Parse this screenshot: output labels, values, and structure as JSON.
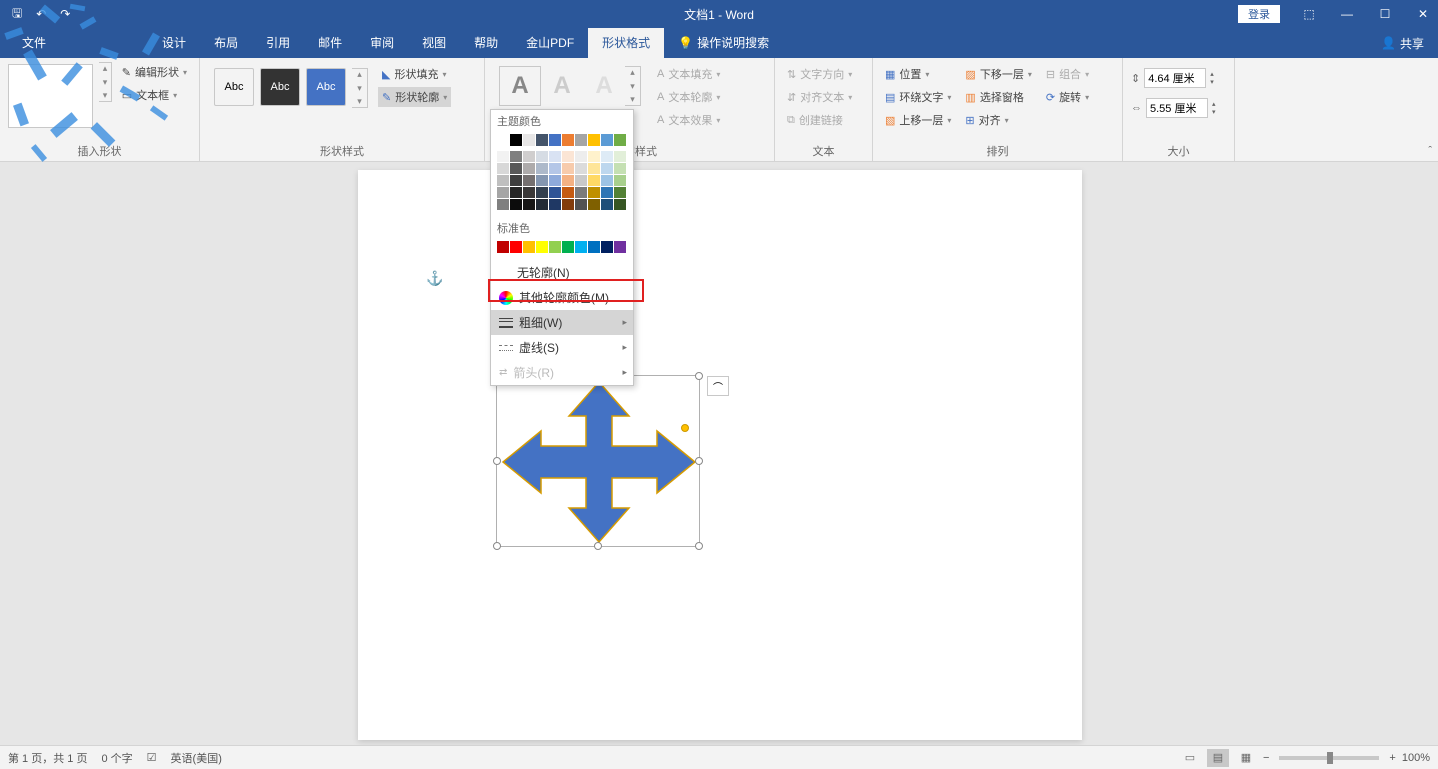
{
  "title_bar": {
    "document_title": "文档1 - Word",
    "login_button": "登录"
  },
  "tabs": {
    "file": "文件",
    "design": "设计",
    "layout": "布局",
    "references": "引用",
    "mailings": "邮件",
    "review": "审阅",
    "view": "视图",
    "help": "帮助",
    "kingsoft_pdf": "金山PDF",
    "shape_format": "形状格式",
    "tell_me": "操作说明搜索",
    "share": "共享"
  },
  "ribbon": {
    "insert_shapes_group": "插入形状",
    "edit_shape": "编辑形状",
    "text_box": "文本框",
    "shape_styles_group": "形状样式",
    "style_abc": "Abc",
    "shape_fill": "形状填充",
    "shape_outline": "形状轮廓",
    "wordart_styles_group": "艺术字样式",
    "text_fill": "文本填充",
    "text_outline": "文本轮廓",
    "text_effects": "文本效果",
    "text_group": "文本",
    "text_direction": "文字方向",
    "align_text": "对齐文本",
    "create_link": "创建链接",
    "arrange_group": "排列",
    "position": "位置",
    "wrap_text": "环绕文字",
    "bring_forward": "上移一层",
    "send_backward": "下移一层",
    "selection_pane": "选择窗格",
    "align": "对齐",
    "group_btn": "组合",
    "rotate": "旋转",
    "size_group": "大小",
    "height_value": "4.64 厘米",
    "width_value": "5.55 厘米"
  },
  "dropdown": {
    "theme_colors": "主题颜色",
    "standard_colors": "标准色",
    "no_outline": "无轮廓(N)",
    "more_colors": "其他轮廓颜色(M)...",
    "weight": "粗细(W)",
    "dashes": "虚线(S)",
    "arrows": "箭头(R)"
  },
  "status_bar": {
    "page_info": "第 1 页，共 1 页",
    "word_count": "0 个字",
    "language": "英语(美国)",
    "zoom": "100%"
  },
  "colors": {
    "theme_row1": [
      "#ffffff",
      "#000000",
      "#e7e6e6",
      "#44546a",
      "#4472c4",
      "#ed7d31",
      "#a5a5a5",
      "#ffc000",
      "#5b9bd5",
      "#70ad47"
    ],
    "theme_shades": [
      [
        "#f2f2f2",
        "#7f7f7f",
        "#d0cece",
        "#d6dce4",
        "#d9e2f3",
        "#fbe5d5",
        "#ededed",
        "#fff2cc",
        "#deebf6",
        "#e2efd9"
      ],
      [
        "#d8d8d8",
        "#595959",
        "#aeabab",
        "#adb9ca",
        "#b4c6e7",
        "#f7cbac",
        "#dbdbdb",
        "#fee599",
        "#bdd7ee",
        "#c5e0b3"
      ],
      [
        "#bfbfbf",
        "#3f3f3f",
        "#757070",
        "#8496b0",
        "#8eaadb",
        "#f4b183",
        "#c9c9c9",
        "#ffd965",
        "#9cc3e5",
        "#a8d08d"
      ],
      [
        "#a5a5a5",
        "#262626",
        "#3a3838",
        "#323f4f",
        "#2f5496",
        "#c55a11",
        "#7b7b7b",
        "#bf9000",
        "#2e75b5",
        "#538135"
      ],
      [
        "#7f7f7f",
        "#0c0c0c",
        "#171616",
        "#222a35",
        "#1f3864",
        "#833c0b",
        "#525252",
        "#7f6000",
        "#1e4e79",
        "#375623"
      ]
    ],
    "standard": [
      "#c00000",
      "#ff0000",
      "#ffc000",
      "#ffff00",
      "#92d050",
      "#00b050",
      "#00b0f0",
      "#0070c0",
      "#002060",
      "#7030a0"
    ]
  }
}
